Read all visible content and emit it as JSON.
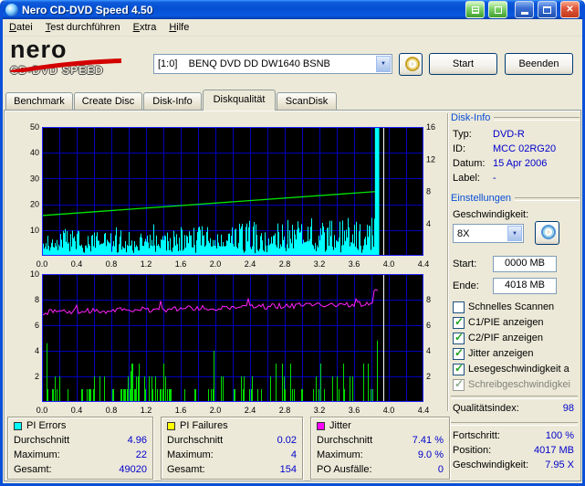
{
  "window": {
    "title": "Nero CD-DVD Speed 4.50"
  },
  "icons": {
    "close": "✕",
    "dropdown": "▼",
    "check": "✓"
  },
  "menu": {
    "items": [
      "Datei",
      "Test durchführen",
      "Extra",
      "Hilfe"
    ]
  },
  "logo": {
    "brand": "nero",
    "product": "CD-DVD SPEED"
  },
  "toolbar": {
    "drive": "[1:0]    BENQ DVD DD DW1640 BSNB",
    "start_label": "Start",
    "quit_label": "Beenden"
  },
  "tabs": {
    "items": [
      {
        "label": "Benchmark"
      },
      {
        "label": "Create Disc"
      },
      {
        "label": "Disk-Info"
      },
      {
        "label": "Diskqualität"
      },
      {
        "label": "ScanDisk"
      }
    ],
    "active_index": 3
  },
  "disk_info": {
    "header": "Disk-Info",
    "rows": [
      {
        "label": "Typ:",
        "value": "DVD-R"
      },
      {
        "label": "ID:",
        "value": "MCC 02RG20"
      },
      {
        "label": "Datum:",
        "value": "15 Apr 2006"
      },
      {
        "label": "Label:",
        "value": "-"
      }
    ]
  },
  "settings": {
    "header": "Einstellungen",
    "speed_label": "Geschwindigkeit:",
    "speed_value": "8X",
    "start_label": "Start:",
    "start_value": "0000 MB",
    "end_label": "Ende:",
    "end_value": "4018 MB",
    "checkboxes": [
      {
        "label": "Schnelles Scannen",
        "checked": false
      },
      {
        "label": "C1/PIE anzeigen",
        "checked": true
      },
      {
        "label": "C2/PIF anzeigen",
        "checked": true
      },
      {
        "label": "Jitter anzeigen",
        "checked": true
      },
      {
        "label": "Lesegeschwindigkeit a",
        "checked": true
      },
      {
        "label": "Schreibgeschwindigkei",
        "checked": true,
        "disabled": true
      }
    ]
  },
  "quality": {
    "label": "Qualitätsindex:",
    "value": "98"
  },
  "progress": {
    "rows": [
      {
        "label": "Fortschritt:",
        "value": "100 %"
      },
      {
        "label": "Position:",
        "value": "4017 MB"
      },
      {
        "label": "Geschwindigkeit:",
        "value": "7.95 X"
      }
    ]
  },
  "stats": [
    {
      "title": "PI Errors",
      "color": "#00ffff",
      "rows": [
        {
          "label": "Durchschnitt",
          "value": "4.96"
        },
        {
          "label": "Maximum:",
          "value": "22"
        },
        {
          "label": "Gesamt:",
          "value": "49020"
        }
      ]
    },
    {
      "title": "PI Failures",
      "color": "#ffff00",
      "rows": [
        {
          "label": "Durchschnitt",
          "value": "0.02"
        },
        {
          "label": "Maximum:",
          "value": "4"
        },
        {
          "label": "Gesamt:",
          "value": "154"
        }
      ]
    },
    {
      "title": "Jitter",
      "color": "#ff00ff",
      "rows": [
        {
          "label": "Durchschnitt",
          "value": "7.41 %"
        },
        {
          "label": "Maximum:",
          "value": "9.0 %"
        },
        {
          "label": "PO Ausfälle:",
          "value": "0"
        }
      ]
    }
  ],
  "chart_data": [
    {
      "type": "area",
      "name": "PI Errors / Lesegeschwindigkeit",
      "xlim": [
        0,
        4.4
      ],
      "x_ticks": [
        "0.0",
        "0.4",
        "0.8",
        "1.2",
        "1.6",
        "2.0",
        "2.4",
        "2.8",
        "3.2",
        "3.6",
        "4.0",
        "4.4"
      ],
      "data_end_x": 3.88,
      "cursor_x": 3.94,
      "bg": "#000000",
      "grid_color": "#0000b8",
      "border_color": "#2121ff",
      "left_axis": {
        "range": [
          0,
          50
        ],
        "ticks": [
          50,
          40,
          30,
          20,
          10
        ]
      },
      "right_axis": {
        "range": [
          0,
          16
        ],
        "ticks": [
          16,
          12,
          8,
          4
        ]
      },
      "series": [
        {
          "name": "PI Errors",
          "style": "spikes",
          "axis": "left",
          "color": "#00ffff",
          "average": 4.96,
          "maximum": 22
        },
        {
          "name": "Lesegeschwindigkeit",
          "style": "line",
          "axis": "right",
          "color": "#00e400",
          "start_value": 5.0,
          "end_value": 8.0
        }
      ],
      "end_block": {
        "x1": 3.84,
        "x2": 3.89,
        "color": "#00ffff"
      }
    },
    {
      "type": "mixed",
      "name": "PI Failures / Jitter",
      "xlim": [
        0,
        4.4
      ],
      "x_ticks": [
        "0.0",
        "0.4",
        "0.8",
        "1.2",
        "1.6",
        "2.0",
        "2.4",
        "2.8",
        "3.2",
        "3.6",
        "4.0",
        "4.4"
      ],
      "data_end_x": 3.88,
      "cursor_x": 3.94,
      "bg": "#000000",
      "grid_color": "#0000b8",
      "border_color": "#2121ff",
      "left_axis": {
        "range": [
          0,
          10
        ],
        "ticks": [
          10,
          8,
          6,
          4,
          2
        ]
      },
      "right_axis": {
        "range": [
          0,
          10
        ],
        "ticks": [
          8,
          6,
          4,
          2
        ]
      },
      "series": [
        {
          "name": "PI Failures",
          "style": "spikes-sparse",
          "axis": "left",
          "color": "#00dd00",
          "average": 0.02,
          "maximum": 4,
          "total": 154,
          "notable": [
            {
              "x": 0.05,
              "h": 4.6
            },
            {
              "x": 1.02,
              "h": 2.4
            },
            {
              "x": 1.12,
              "h": 3.0
            },
            {
              "x": 1.3,
              "h": 2.0
            },
            {
              "x": 2.3,
              "h": 2.0
            },
            {
              "x": 3.86,
              "h": 4.8
            }
          ]
        },
        {
          "name": "Jitter",
          "style": "line-noisy",
          "axis": "left",
          "color": "#ff22ff",
          "average": 7.41,
          "maximum": 9.0,
          "start_value": 7.0,
          "end_value": 7.7
        }
      ]
    }
  ]
}
